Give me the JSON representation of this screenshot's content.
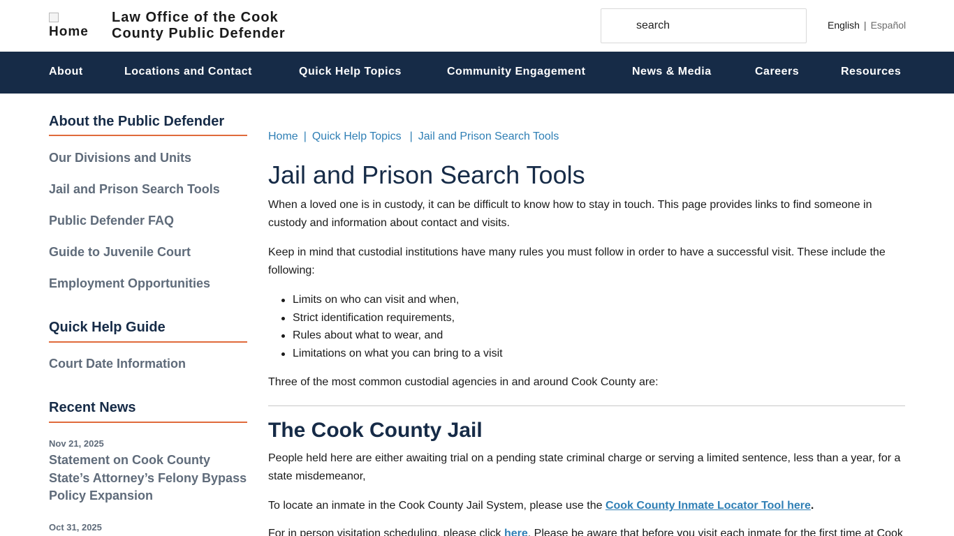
{
  "header": {
    "logo_alt": "Home",
    "site_title": "Law Office of the Cook County Public Defender",
    "search_placeholder": "search",
    "lang_english": "English",
    "lang_separator": "|",
    "lang_spanish": "Español"
  },
  "nav": {
    "items": [
      {
        "label": "About"
      },
      {
        "label": "Locations and Contact"
      },
      {
        "label": "Quick Help Topics"
      },
      {
        "label": "Community Engagement"
      },
      {
        "label": "News & Media"
      },
      {
        "label": "Careers"
      },
      {
        "label": "Resources"
      }
    ]
  },
  "sidebar": {
    "about_heading": "About the Public Defender",
    "about_links": [
      {
        "label": "Our Divisions and Units"
      },
      {
        "label": "Jail and Prison Search Tools"
      },
      {
        "label": "Public Defender FAQ"
      },
      {
        "label": "Guide to Juvenile Court"
      },
      {
        "label": "Employment Opportunities"
      }
    ],
    "quick_heading": "Quick Help Guide",
    "quick_links": [
      {
        "label": "Court Date Information"
      }
    ],
    "news_heading": "Recent News",
    "news": [
      {
        "date": "Nov 21, 2025",
        "title": "Statement on Cook County State’s Attorney’s Felony Bypass Policy Expansion"
      },
      {
        "date": "Oct 31, 2025",
        "title": ""
      }
    ]
  },
  "breadcrumb": {
    "home": "Home",
    "sep": "|",
    "quick_help": "Quick Help Topics",
    "current": "Jail and Prison Search Tools"
  },
  "main": {
    "title": "Jail and Prison Search Tools",
    "intro": "When a loved one is in custody, it can be difficult to know how to stay in touch. This page provides links to find someone in custody and information about contact and visits.",
    "rules_intro": "Keep in mind that custodial institutions have many rules you must follow in order to have a successful visit. These include the following:",
    "bullets": [
      "Limits on who can visit and when,",
      "Strict identification requirements,",
      "Rules about what to wear, and",
      "Limitations on what you can bring to a visit"
    ],
    "agencies_intro": "Three of the most common custodial agencies in and around Cook County are:",
    "section_title": "The Cook County Jail",
    "jail_desc": "People held here are either awaiting trial on a pending state criminal charge or serving a limited sentence, less than a year, for a state misdemeanor,",
    "locator_text": "To locate an inmate in the Cook County Jail System, please use the ",
    "locator_link": "Cook County Inmate Locator Tool here",
    "locator_end": ".",
    "visit_text": "For in person visitation scheduling, please click ",
    "visit_link": "here",
    "visit_rest": ". Please be aware that before you visit each inmate for the first time at Cook"
  }
}
